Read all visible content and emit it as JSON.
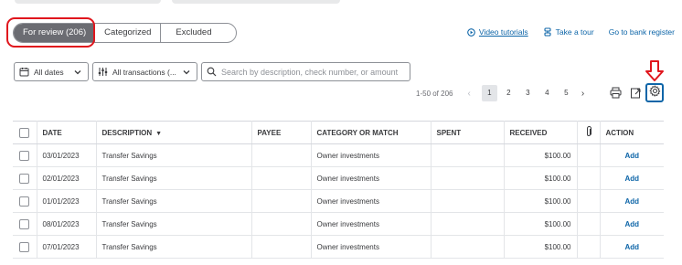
{
  "tabs": [
    {
      "label": "For review (206)",
      "active": true
    },
    {
      "label": "Categorized",
      "active": false
    },
    {
      "label": "Excluded",
      "active": false
    }
  ],
  "top_links": {
    "video_tutorials": "Video tutorials",
    "take_tour": "Take a tour",
    "bank_register": "Go to bank register"
  },
  "filters": {
    "dates": "All dates",
    "transactions": "All transactions (...",
    "search_placeholder": "Search by description, check number, or amount"
  },
  "pagination": {
    "range": "1-50 of 206",
    "pages": [
      "1",
      "2",
      "3",
      "4",
      "5"
    ],
    "current": "1"
  },
  "table": {
    "headers": {
      "date": "DATE",
      "description": "DESCRIPTION",
      "payee": "PAYEE",
      "category": "CATEGORY OR MATCH",
      "spent": "SPENT",
      "received": "RECEIVED",
      "action": "ACTION"
    },
    "rows": [
      {
        "date": "03/01/2023",
        "description": "Transfer Savings",
        "payee": "",
        "category": "Owner investments",
        "spent": "",
        "received": "$100.00",
        "action": "Add"
      },
      {
        "date": "02/01/2023",
        "description": "Transfer Savings",
        "payee": "",
        "category": "Owner investments",
        "spent": "",
        "received": "$100.00",
        "action": "Add"
      },
      {
        "date": "01/01/2023",
        "description": "Transfer Savings",
        "payee": "",
        "category": "Owner investments",
        "spent": "",
        "received": "$100.00",
        "action": "Add"
      },
      {
        "date": "08/01/2023",
        "description": "Transfer Savings",
        "payee": "",
        "category": "Owner investments",
        "spent": "",
        "received": "$100.00",
        "action": "Add"
      },
      {
        "date": "07/01/2023",
        "description": "Transfer Savings",
        "payee": "",
        "category": "Owner investments",
        "spent": "",
        "received": "$100.00",
        "action": "Add"
      }
    ]
  },
  "colors": {
    "accent": "#0d65a8",
    "highlight": "#e0161d",
    "active_tab": "#6b6c72"
  },
  "icons": [
    "play-circle-icon",
    "tour-icon",
    "calendar-icon",
    "filter-icon",
    "search-icon",
    "chevron-down-icon",
    "print-icon",
    "export-icon",
    "gear-icon",
    "attachment-icon",
    "down-arrow-icon"
  ]
}
